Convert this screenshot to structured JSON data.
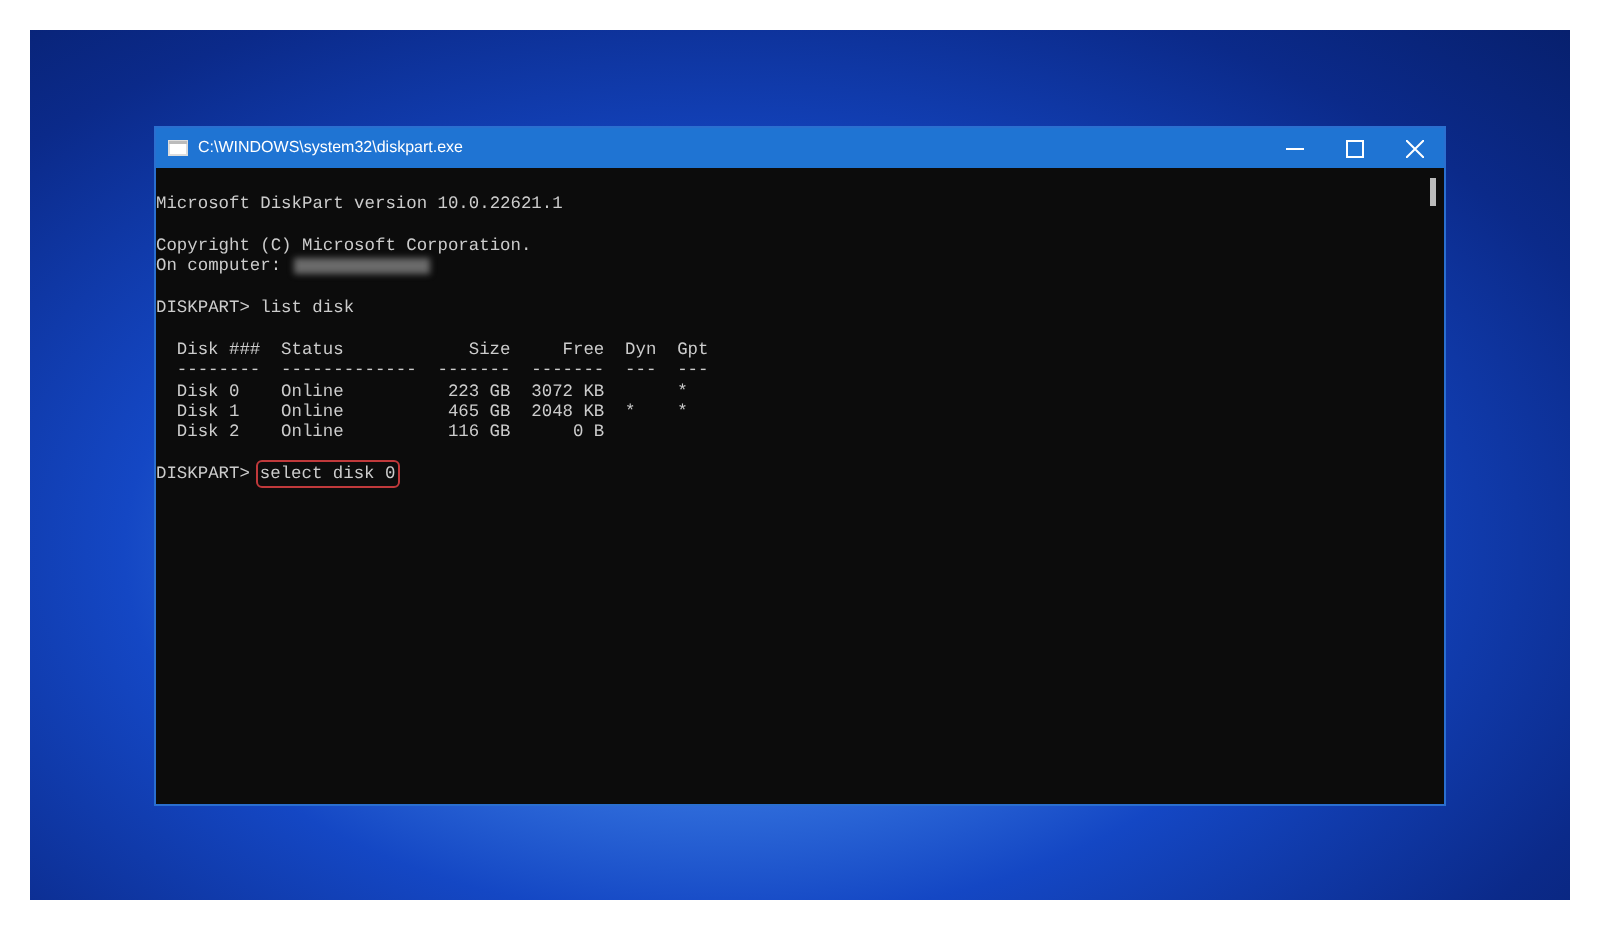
{
  "window": {
    "title": "C:\\WINDOWS\\system32\\diskpart.exe"
  },
  "console": {
    "lines": [
      {
        "kind": "text",
        "text": "Microsoft DiskPart version 10.0.22621.1"
      },
      {
        "kind": "blank"
      },
      {
        "kind": "text",
        "text": "Copyright (C) Microsoft Corporation."
      },
      {
        "kind": "redacted",
        "text": "On computer:"
      },
      {
        "kind": "blank"
      },
      {
        "kind": "command",
        "prompt": "DISKPART>",
        "command": "list disk",
        "highlighted": false
      },
      {
        "kind": "blank"
      },
      {
        "kind": "table",
        "columns": [
          {
            "label": "Disk ###",
            "rule": "--------"
          },
          {
            "label": "Status",
            "rule": "-------------"
          },
          {
            "label": "Size",
            "rule": "-------"
          },
          {
            "label": "Free",
            "rule": "-------"
          },
          {
            "label": "Dyn",
            "rule": "---"
          },
          {
            "label": "Gpt",
            "rule": "---"
          }
        ],
        "rows": [
          [
            "Disk 0",
            "Online",
            "223 GB",
            "3072 KB",
            null,
            "*"
          ],
          [
            "Disk 1",
            "Online",
            "465 GB",
            "2048 KB",
            "*",
            "*"
          ],
          [
            "Disk 2",
            "Online",
            "116 GB",
            "0 B",
            null,
            null
          ]
        ]
      },
      {
        "kind": "blank"
      },
      {
        "kind": "command",
        "prompt": "DISKPART>",
        "command": "select disk 0",
        "highlighted": true
      }
    ]
  }
}
